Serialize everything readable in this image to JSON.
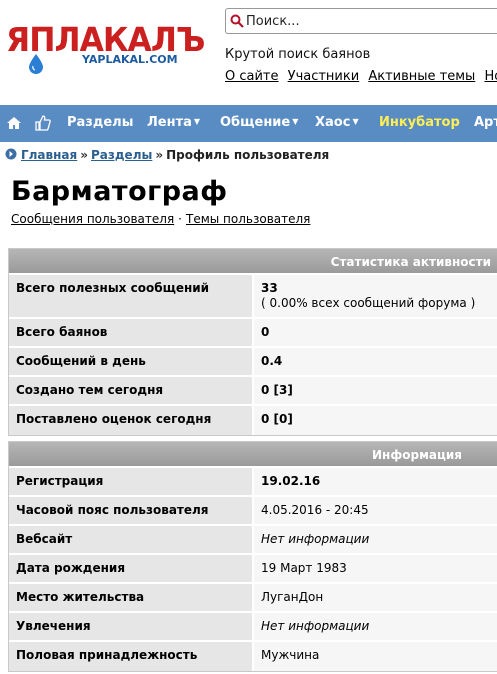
{
  "logo": {
    "main": "ЯПЛАКАЛЪ",
    "sub": "YAPLAKAL.COM"
  },
  "search": {
    "placeholder": "Поиск..."
  },
  "slogan": "Крутой поиск баянов",
  "top_links": [
    "О сайте",
    "Участники",
    "Активные темы",
    "Нов"
  ],
  "nav": {
    "home_icon": "home-icon",
    "like_icon": "thumbs-up-icon",
    "items": [
      {
        "label": "Разделы",
        "caret": ""
      },
      {
        "label": "Лента",
        "caret": "▼"
      },
      {
        "label": "Общение",
        "caret": "▼"
      },
      {
        "label": "Хаос",
        "caret": "▼"
      },
      {
        "label": "Инкубатор",
        "caret": ""
      },
      {
        "label": "Арт",
        "caret": ""
      }
    ]
  },
  "breadcrumb": {
    "home": "Главная",
    "sep": "»",
    "section": "Разделы",
    "current": "Профиль пользователя"
  },
  "profile": {
    "name": "Барматограф",
    "link_posts": "Сообщения пользователя",
    "dot": "·",
    "link_topics": "Темы пользователя"
  },
  "activity": {
    "header": "Статистика активности",
    "rows": [
      {
        "k": "Всего полезных сообщений",
        "v": "33",
        "note": "( 0.00% всех сообщений форума )"
      },
      {
        "k": "Всего баянов",
        "v": "0"
      },
      {
        "k": "Сообщений в день",
        "v": "0.4"
      },
      {
        "k": "Создано тем сегодня",
        "v": "0 [3]"
      },
      {
        "k": "Поставлено оценок сегодня",
        "v": "0 [0]"
      }
    ]
  },
  "info": {
    "header": "Информация",
    "rows": [
      {
        "k": "Регистрация",
        "v": "19.02.16"
      },
      {
        "k": "Часовой пояс пользователя",
        "v": "4.05.2016 - 20:45"
      },
      {
        "k": "Вебсайт",
        "v": "Нет информации"
      },
      {
        "k": "Дата рождения",
        "v": "19 Март 1983"
      },
      {
        "k": "Место жительства",
        "v": "ЛуганДон"
      },
      {
        "k": "Увлечения",
        "v": "Нет информации"
      },
      {
        "k": "Половая принадлежность",
        "v": "Мужчина"
      }
    ]
  },
  "colors": {
    "nav_bg": "#5a8cc4",
    "logo_red": "#cc1f1f",
    "link_blue": "#2b5f90",
    "incubator": "#ffee55"
  }
}
